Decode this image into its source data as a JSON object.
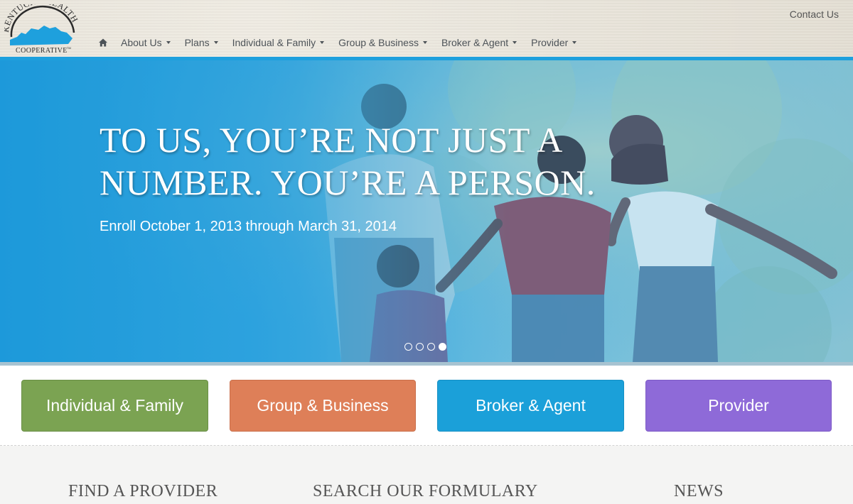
{
  "header": {
    "logo_text_top": "KENTUCKY HEALTH",
    "logo_text_bottom": "COOPERATIVE",
    "logo_tm": "TM",
    "contact_label": "Contact Us",
    "nav": [
      {
        "label": "About Us"
      },
      {
        "label": "Plans"
      },
      {
        "label": "Individual & Family"
      },
      {
        "label": "Group & Business"
      },
      {
        "label": "Broker & Agent"
      },
      {
        "label": "Provider"
      }
    ]
  },
  "hero": {
    "title_line1": "TO US, YOU’RE NOT JUST A",
    "title_line2": "NUMBER. YOU’RE A PERSON.",
    "subtitle": "Enroll October 1, 2013 through March 31, 2014",
    "slides_total": 4,
    "slide_active": 4
  },
  "ctas": {
    "individual": "Individual & Family",
    "group": "Group & Business",
    "broker": "Broker & Agent",
    "provider": "Provider"
  },
  "sections": {
    "find_provider": "FIND A PROVIDER",
    "formulary": "SEARCH OUR FORMULARY",
    "news": "NEWS"
  },
  "colors": {
    "accent_blue": "#1ea0dd",
    "green": "#7ba352",
    "orange": "#de7f58",
    "blue": "#1ba0d9",
    "purple": "#8e6ad8"
  },
  "icons": {
    "home": "home-icon"
  }
}
